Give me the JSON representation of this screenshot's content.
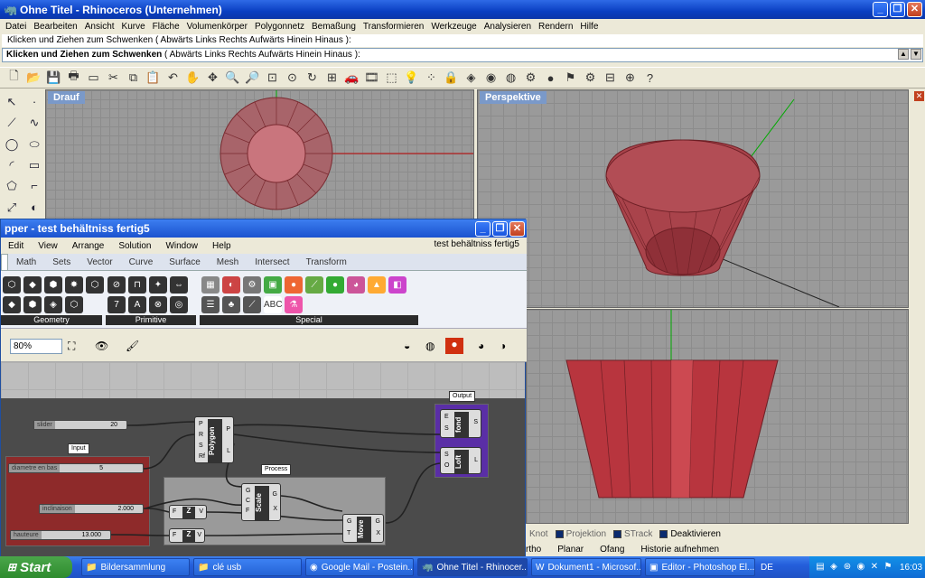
{
  "window": {
    "title": "Ohne Titel - Rhinoceros (Unternehmen)"
  },
  "menubar": [
    "Datei",
    "Bearbeiten",
    "Ansicht",
    "Kurve",
    "Fläche",
    "Volumenkörper",
    "Polygonnetz",
    "Bemaßung",
    "Transformieren",
    "Werkzeuge",
    "Analysieren",
    "Rendern",
    "Hilfe"
  ],
  "command": {
    "history": "Klicken und Ziehen zum Schwenken ( Abwärts  Links  Rechts  Aufwärts  Hinein  Hinaus ):",
    "prompt_lead": "Klicken und Ziehen zum Schwenken",
    "prompt_options": " ( Abwärts  Links  Rechts  Aufwärts  Hinein  Hinaus ):"
  },
  "viewports": {
    "top": "Drauf",
    "perspective": "Perspektive"
  },
  "statusbar": {
    "toggles": [
      {
        "label": "Knot",
        "on": false
      },
      {
        "label": "Projektion",
        "on": false
      },
      {
        "label": "STrack",
        "on": false
      },
      {
        "label": "Deaktivieren",
        "on": true
      }
    ],
    "row2": [
      "rtho",
      "Planar",
      "Ofang",
      "Historie aufnehmen"
    ]
  },
  "grasshopper": {
    "title": "pper - test behältniss fertig5",
    "menu": [
      "Edit",
      "View",
      "Arrange",
      "Solution",
      "Window",
      "Help"
    ],
    "document_name": "test behältniss fertig5",
    "tabs": [
      "Math",
      "Sets",
      "Vector",
      "Curve",
      "Surface",
      "Mesh",
      "Intersect",
      "Transform"
    ],
    "ribbon_groups": [
      "Geometry",
      "Primitive",
      "Special"
    ],
    "zoom": "80%",
    "groups": {
      "input": "Input",
      "process": "Process",
      "output": "Output"
    },
    "sliders": [
      {
        "name": "slider",
        "value": "20"
      },
      {
        "name": "diametre en bas",
        "value": "5"
      },
      {
        "name": "inclinaison",
        "value": "2.000"
      },
      {
        "name": "hauteure",
        "value": "13.000"
      }
    ],
    "components": {
      "polygon": "Polygon",
      "scale": "Scale",
      "move": "Move",
      "fond": "fond",
      "loft": "Loft"
    }
  },
  "taskbar": {
    "start": "Start",
    "items": [
      {
        "label": "Bildersammlung",
        "active": false
      },
      {
        "label": "clé usb",
        "active": false
      },
      {
        "label": "Google Mail - Postein...",
        "active": false
      },
      {
        "label": "Ohne Titel - Rhinocer...",
        "active": true
      },
      {
        "label": "Dokument1 - Microsof...",
        "active": false
      },
      {
        "label": "Editor - Photoshop El...",
        "active": false
      }
    ],
    "language": "DE",
    "clock": "16:03"
  },
  "colors": {
    "accent": "#0a3fc2",
    "model_red": "#b5343b",
    "grid": "#9a9a9a",
    "output_group": "#5a2ea6",
    "input_group": "#9c2a2a"
  }
}
